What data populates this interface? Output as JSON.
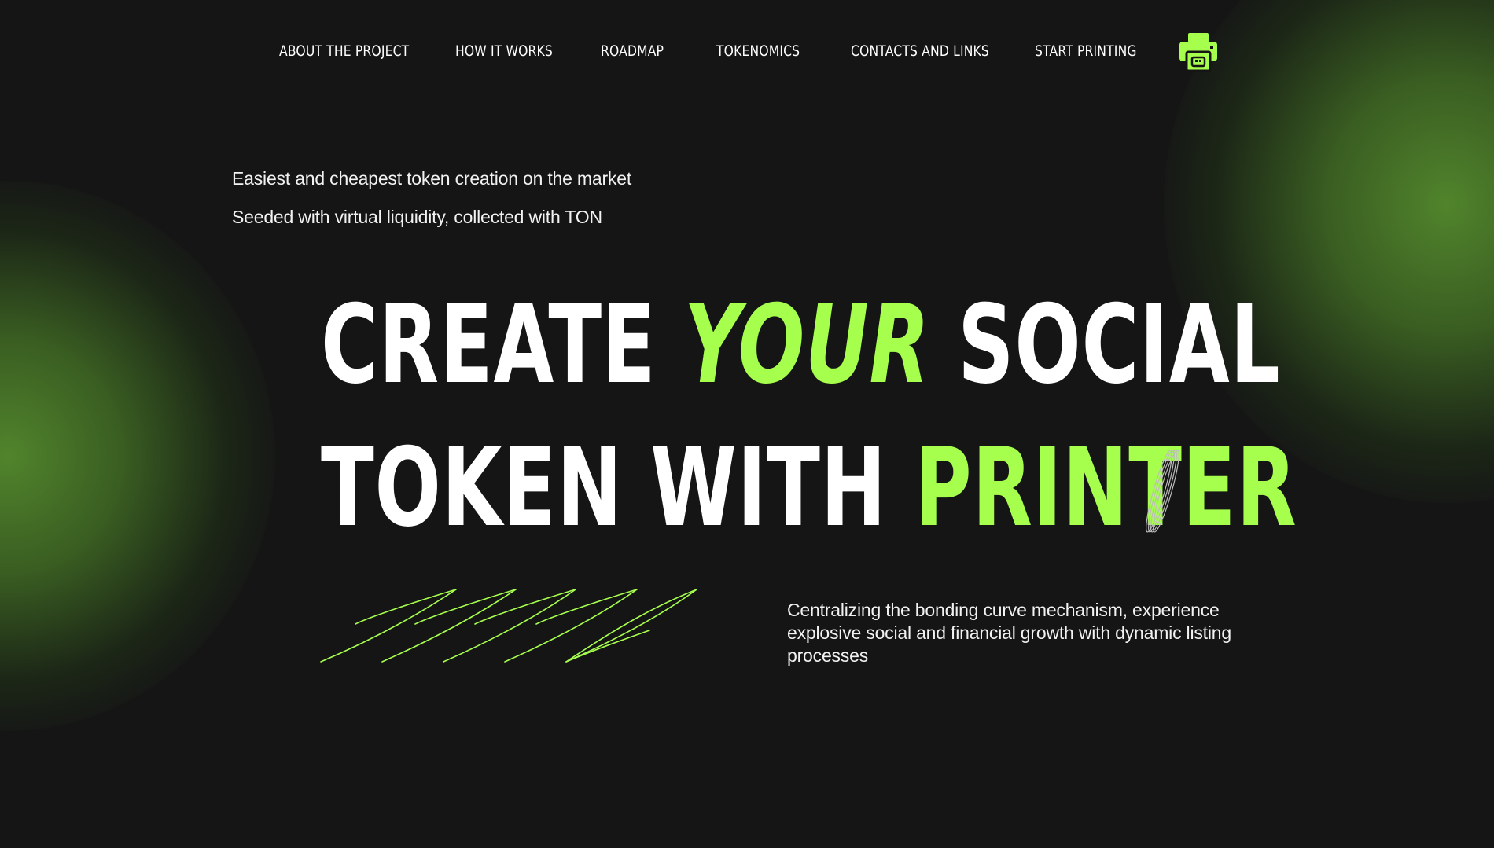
{
  "nav": {
    "items": [
      {
        "label": "ABOUT THE PROJECT"
      },
      {
        "label": "HOW IT WORKS"
      },
      {
        "label": "ROADMAP"
      },
      {
        "label": "TOKENOMICS"
      },
      {
        "label": "CONTACTS AND LINKS"
      },
      {
        "label": "START PRINTING"
      }
    ],
    "logo_icon": "printer-icon"
  },
  "taglines": [
    "Easiest and cheapest token creation on the market",
    "Seeded with virtual liquidity, collected with TON"
  ],
  "hero": {
    "line1": {
      "word1": "CREATE",
      "word2": "YOUR",
      "word3": "SOCIAL"
    },
    "line2": {
      "word1": "TOKEN",
      "word2": "WITH",
      "word3": "PRINTER"
    }
  },
  "description": "Centralizing the bonding curve mechanism, experience explosive social and financial growth with dynamic listing processes",
  "colors": {
    "accent": "#a6ff4d",
    "background": "#151515",
    "glow": "#548a2d",
    "text": "#ffffff"
  }
}
